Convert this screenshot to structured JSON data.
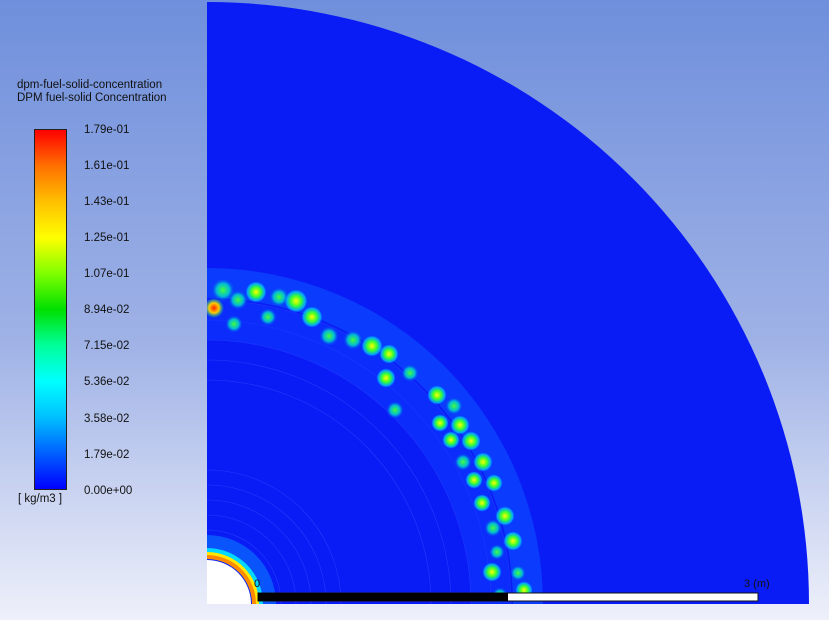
{
  "legend": {
    "variable_name": "dpm-fuel-solid-concentration",
    "variable_title": "DPM fuel-solid Concentration",
    "ticks": [
      "1.79e-01",
      "1.61e-01",
      "1.43e-01",
      "1.25e-01",
      "1.07e-01",
      "8.94e-02",
      "7.15e-02",
      "5.36e-02",
      "3.58e-02",
      "1.79e-02",
      "0.00e+00"
    ],
    "unit": "[ kg/m3 ]"
  },
  "scale_bar": {
    "start_label": "0",
    "end_label": "3 (m)"
  }
}
